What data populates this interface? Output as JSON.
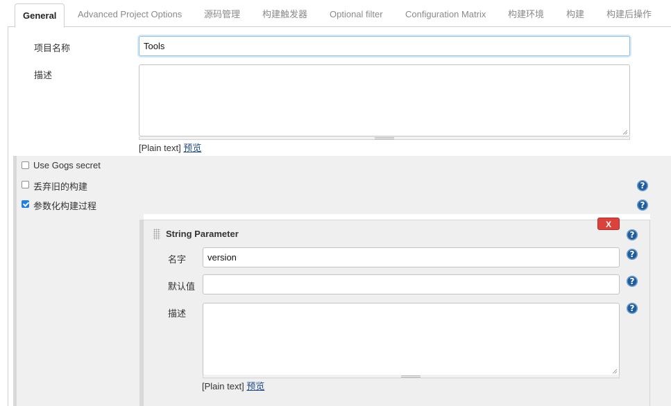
{
  "tabs": [
    {
      "label": "General",
      "active": true
    },
    {
      "label": "Advanced Project Options"
    },
    {
      "label": "源码管理"
    },
    {
      "label": "构建触发器"
    },
    {
      "label": "Optional filter"
    },
    {
      "label": "Configuration Matrix"
    },
    {
      "label": "构建环境"
    },
    {
      "label": "构建"
    },
    {
      "label": "构建后操作"
    }
  ],
  "general": {
    "project_name_label": "项目名称",
    "project_name_value": "Tools",
    "description_label": "描述",
    "description_value": "",
    "plain_text": "[Plain text]",
    "preview": "预览"
  },
  "options": [
    {
      "label": "Use Gogs secret",
      "checked": false
    },
    {
      "label": "丢弃旧的构建",
      "checked": false
    },
    {
      "label": "参数化构建过程",
      "checked": true
    }
  ],
  "string_parameter": {
    "title": "String Parameter",
    "delete_label": "X",
    "name_label": "名字",
    "name_value": "version",
    "default_label": "默认值",
    "default_value": "",
    "description_label": "描述",
    "description_value": "",
    "plain_text": "[Plain text]",
    "preview": "预览"
  },
  "help_glyph": "?",
  "icons": {
    "help": "help-icon",
    "drag": "drag-handle-icon",
    "resize": "resize-grip-icon"
  },
  "colors": {
    "help_blue": "#1f5c99",
    "delete_red": "#d9433b",
    "checkbox_blue": "#1e7fe6",
    "link": "#204a87"
  }
}
